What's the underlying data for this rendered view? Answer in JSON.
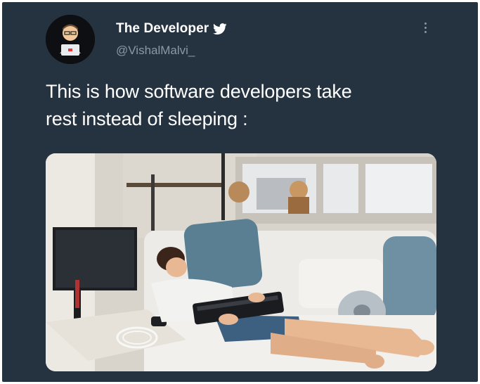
{
  "tweet": {
    "display_name": "The Developer",
    "handle": "@VishalMalvi_",
    "text_line1": "This is how software developers take",
    "text_line2": "rest instead of sleeping :"
  },
  "icons": {
    "verified": "twitter-bird-icon",
    "more": "more-vertical-icon"
  },
  "colors": {
    "background": "#253341",
    "name": "#ffffff",
    "handle": "#8b98a5"
  }
}
